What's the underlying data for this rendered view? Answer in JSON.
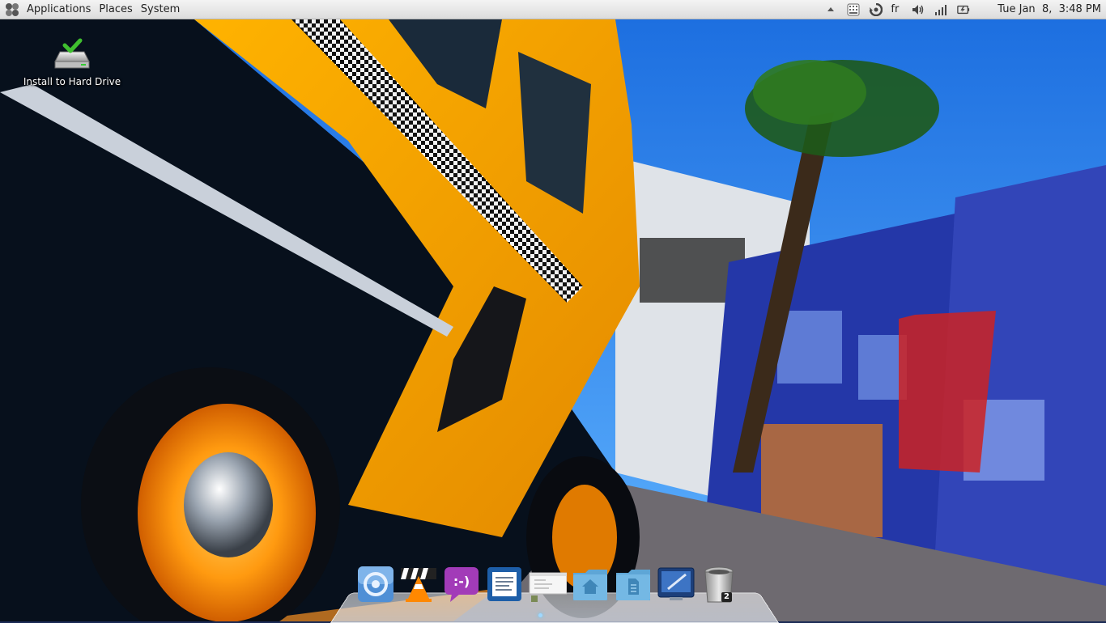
{
  "panel": {
    "menus": [
      "Applications",
      "Places",
      "System"
    ],
    "tray": {
      "icons": [
        "caret-up-icon",
        "keyboard-icon",
        "update-icon"
      ],
      "keyboard_layout": "fr",
      "status_icons": [
        "volume-icon",
        "signal-icon",
        "battery-icon"
      ],
      "clock": "Tue Jan  8,  3:48 PM"
    }
  },
  "desktop": {
    "icons": [
      {
        "label": "Install to Hard Drive",
        "icon": "drive-install-icon"
      }
    ]
  },
  "dock": {
    "items": [
      {
        "name": "chromium",
        "icon": "chromium-icon"
      },
      {
        "name": "vlc",
        "icon": "vlc-icon"
      },
      {
        "name": "pidgin",
        "icon": "pidgin-icon"
      },
      {
        "name": "document-viewer",
        "icon": "document-viewer-icon"
      },
      {
        "name": "window-preview",
        "icon": "window-preview-icon"
      },
      {
        "name": "home-folder",
        "icon": "home-folder-icon"
      },
      {
        "name": "documents",
        "icon": "documents-icon"
      },
      {
        "name": "desktop-settings",
        "icon": "desktop-settings-icon"
      },
      {
        "name": "trash",
        "icon": "trash-icon",
        "badge": "2"
      }
    ]
  },
  "colors": {
    "taxi_yellow": "#f6a600",
    "sky_blue": "#2f8cf0",
    "building_blue": "#2b3fae",
    "panel_bg": "#e6e6e6"
  }
}
